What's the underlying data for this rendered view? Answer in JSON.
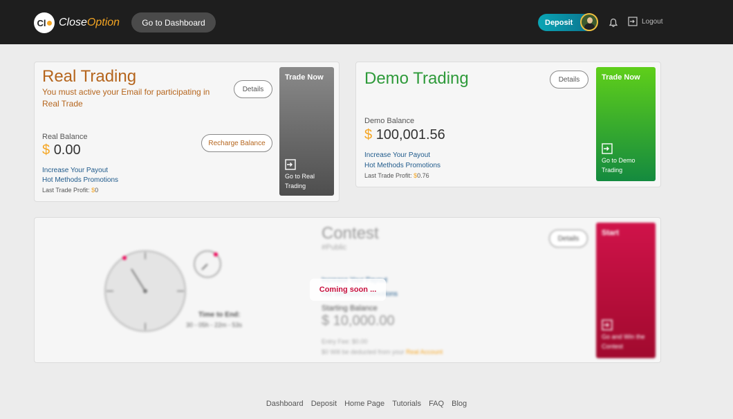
{
  "header": {
    "logo_prefix": "Close",
    "logo_accent": "Option",
    "logo_badge": "Cl",
    "dashboard_button": "Go to Dashboard",
    "deposit_button": "Deposit",
    "logout_label": "Logout",
    "icons": {
      "bell": "bell-icon",
      "logout": "logout-icon",
      "avatar": "avatar"
    }
  },
  "real": {
    "title": "Real Trading",
    "notice": "You must active your Email for participating in Real Trade",
    "details": "Details",
    "balance_label": "Real Balance",
    "currency": "$",
    "balance": "0.00",
    "recharge": "Recharge Balance",
    "link1": "Increase Your Payout",
    "link2": "Hot Methods Promotions",
    "profit_label": "Last Trade Profit:",
    "profit_currency": "$",
    "profit_value": "0",
    "side_title": "Trade Now",
    "side_sub": "Go to Real Trading"
  },
  "demo": {
    "title": "Demo Trading",
    "details": "Details",
    "balance_label": "Demo Balance",
    "currency": "$",
    "balance": "100,001.56",
    "link1": "Increase Your Payout",
    "link2": "Hot Methods Promotions",
    "profit_label": "Last Trade Profit:",
    "profit_currency": "$",
    "profit_value": "0.76",
    "side_title": "Trade Now",
    "side_sub": "Go to Demo Trading"
  },
  "contest": {
    "title": "Contest",
    "subtitle": "#Public",
    "details": "Details",
    "coming_soon": "Coming soon ...",
    "link1": "Increase Your Payout",
    "link2": "Hot Methods Promotions",
    "starting_label": "Starting Balance",
    "starting_balance": "$ 10,000.00",
    "entry_fee": "Entry Fee: $0.00",
    "deduct_note_prefix": "$0 Will be deducted from your",
    "deduct_note_link": "Real Account",
    "time_label": "Time to End:",
    "time_value": "30 - 05h - 22m - 53s",
    "side_title": "Start",
    "side_sub": "Go and Win the Contest"
  },
  "colors": {
    "real_title": "#b5651d",
    "demo_title": "#2e9a3a",
    "accent_orange": "#f5a623",
    "link_blue": "#1f5a8b",
    "contest_pink": "#c8103e"
  },
  "footer": [
    "Dashboard",
    "Deposit",
    "Home Page",
    "Tutorials",
    "FAQ",
    "Blog"
  ]
}
